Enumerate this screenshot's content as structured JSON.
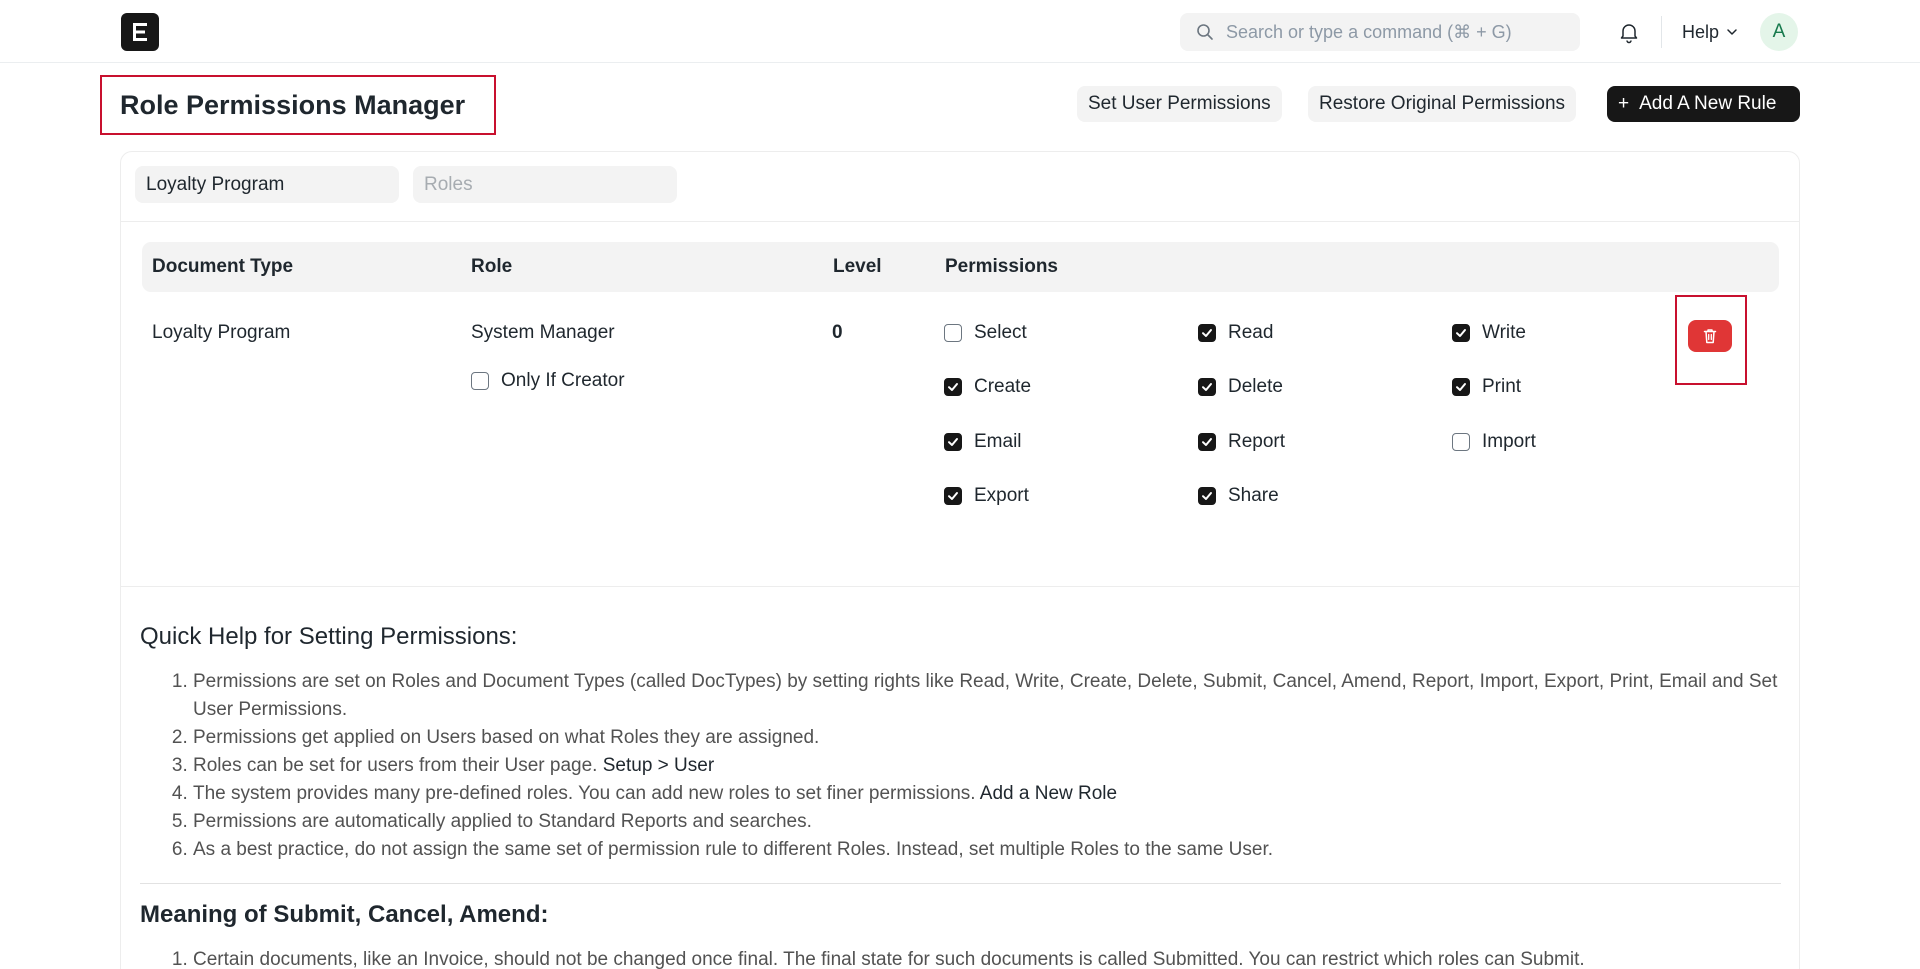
{
  "navbar": {
    "logo_letter": "E",
    "search_placeholder": "Search or type a command (⌘ + G)",
    "help_label": "Help",
    "avatar_initial": "A"
  },
  "page": {
    "title": "Role Permissions Manager",
    "buttons": {
      "set_user_permissions": "Set User Permissions",
      "restore_original": "Restore Original Permissions",
      "add_new_rule": "Add A New Rule",
      "add_new_rule_icon": "+"
    }
  },
  "filters": {
    "document_type_value": "Loyalty Program",
    "roles_placeholder": "Roles"
  },
  "table": {
    "headers": [
      "Document Type",
      "Role",
      "Level",
      "Permissions"
    ],
    "rows": [
      {
        "document_type": "Loyalty Program",
        "role": "System Manager",
        "only_if_creator_label": "Only If Creator",
        "only_if_creator": false,
        "level": "0",
        "permissions": [
          {
            "label": "Select",
            "checked": false
          },
          {
            "label": "Read",
            "checked": true
          },
          {
            "label": "Write",
            "checked": true
          },
          {
            "label": "Create",
            "checked": true
          },
          {
            "label": "Delete",
            "checked": true
          },
          {
            "label": "Print",
            "checked": true
          },
          {
            "label": "Email",
            "checked": true
          },
          {
            "label": "Report",
            "checked": true
          },
          {
            "label": "Import",
            "checked": false
          },
          {
            "label": "Export",
            "checked": true
          },
          {
            "label": "Share",
            "checked": true
          }
        ]
      }
    ]
  },
  "quick_help": {
    "title": "Quick Help for Setting Permissions:",
    "items": [
      {
        "text": "Permissions are set on Roles and Document Types (called DocTypes) by setting rights like Read, Write, Create, Delete, Submit, Cancel, Amend, Report, Import, Export, Print, Email and Set User Permissions.",
        "link": ""
      },
      {
        "text": "Permissions get applied on Users based on what Roles they are assigned.",
        "link": ""
      },
      {
        "text": "Roles can be set for users from their User page. ",
        "link": "Setup > User"
      },
      {
        "text": "The system provides many pre-defined roles. You can add new roles to set finer permissions. ",
        "link": "Add a New Role"
      },
      {
        "text": "Permissions are automatically applied to Standard Reports and searches.",
        "link": ""
      },
      {
        "text": "As a best practice, do not assign the same set of permission rule to different Roles. Instead, set multiple Roles to the same User.",
        "link": ""
      }
    ]
  },
  "meaning": {
    "title": "Meaning of Submit, Cancel, Amend:",
    "items": [
      "Certain documents, like an Invoice, should not be changed once final. The final state for such documents is called Submitted. You can restrict which roles can Submit."
    ]
  },
  "colors": {
    "primary_dark": "#171717",
    "danger": "#e03636",
    "highlight_border": "#c8102e",
    "avatar_bg": "#e4f5e9",
    "avatar_fg": "#16794c"
  }
}
